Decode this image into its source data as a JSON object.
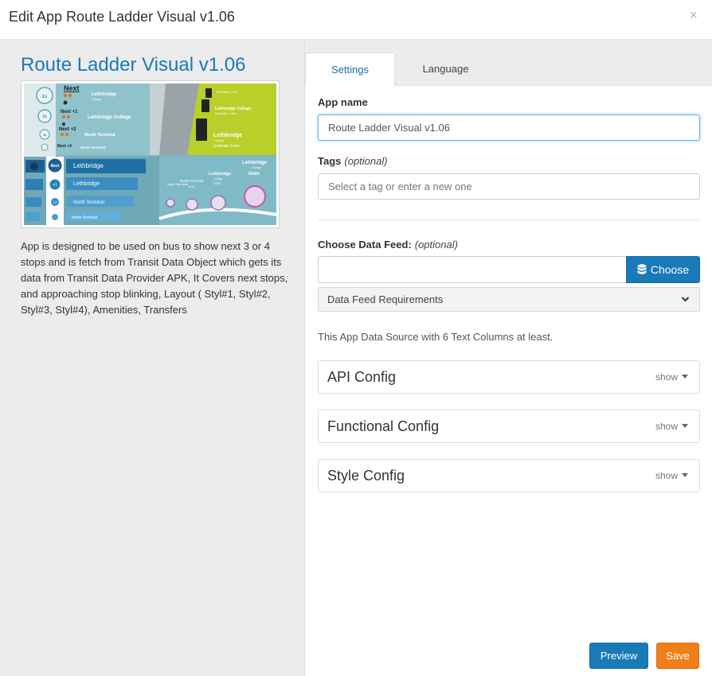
{
  "modal": {
    "title": "Edit App Route Ladder Visual v1.06",
    "close_glyph": "×"
  },
  "app": {
    "heading": "Route Ladder Visual v1.06",
    "description": "App is designed to be used on bus to show next 3 or 4 stops and is fetch from Transit Data Object which gets its data from Transit Data Provider APK, It Covers next stops, and approaching stop blinking, Layout ( Styl#1, Styl#2, Styl#3, Styl#4), Amenities, Transfers"
  },
  "preview": {
    "next": "Next",
    "next1": "Next +1",
    "next2": "Next +2",
    "next3": "Next +3",
    "s1": "1s",
    "s2": "2s",
    "s3": "3s",
    "lethbridge": "Lethbridge",
    "college": "College",
    "lethbridge_college": "Lethbridge College",
    "north_terminal": "North Terminal",
    "estimate_1": "Estimate 1 min",
    "estimate_0": "Estimate 0 min",
    "plus1": "+1",
    "plus2": "+2",
    "min2": "2min",
    "min1": "1min",
    "min0": "0min"
  },
  "tabs": {
    "settings": "Settings",
    "language": "Language"
  },
  "form": {
    "app_name_label": "App name",
    "app_name_value": "Route Ladder Visual v1.06",
    "tags_label": "Tags",
    "tags_optional": "(optional)",
    "tags_placeholder": "Select a tag or enter a new one",
    "feed_label": "Choose Data Feed:",
    "feed_optional": "(optional)",
    "choose_label": "Choose",
    "requirements_label": "Data Feed Requirements",
    "source_note": "This App Data Source with 6 Text Columns at least."
  },
  "panels": [
    {
      "title": "API Config",
      "show": "show"
    },
    {
      "title": "Functional Config",
      "show": "show"
    },
    {
      "title": "Style Config",
      "show": "show"
    }
  ],
  "buttons": {
    "preview": "Preview",
    "save": "Save"
  },
  "colors": {
    "primary": "#1a7ab8",
    "save": "#f07f1a",
    "teal": "#7fb6c0",
    "lime": "#b9cf2a"
  },
  "icons": {
    "close": "close-icon",
    "database": "database-icon",
    "chevron": "chevron-down-icon",
    "caret": "caret-down-icon"
  }
}
